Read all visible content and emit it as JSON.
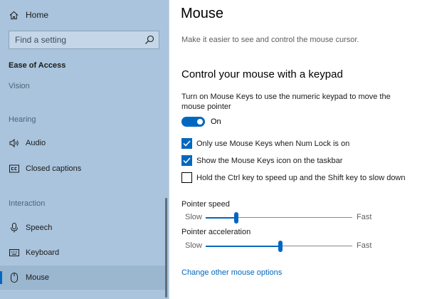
{
  "sidebar": {
    "home_label": "Home",
    "search_placeholder": "Find a setting",
    "section_heading": "Ease of Access",
    "groups": {
      "vision": "Vision",
      "hearing": "Hearing",
      "interaction": "Interaction"
    },
    "items": [
      {
        "label": "Audio",
        "icon": "speaker-icon"
      },
      {
        "label": "Closed captions",
        "icon": "closed-captions-icon"
      },
      {
        "label": "Speech",
        "icon": "microphone-icon"
      },
      {
        "label": "Keyboard",
        "icon": "keyboard-icon"
      },
      {
        "label": "Mouse",
        "icon": "mouse-icon",
        "selected": true
      }
    ]
  },
  "main": {
    "title": "Mouse",
    "description": "Make it easier to see and control the mouse cursor.",
    "section_title": "Control your mouse with a keypad",
    "mouse_keys_intro": "Turn on Mouse Keys to use the numeric keypad to move the mouse pointer",
    "toggle": {
      "state_label": "On",
      "on": true
    },
    "checkboxes": [
      {
        "label": "Only use Mouse Keys when Num Lock is on",
        "checked": true
      },
      {
        "label": "Show the Mouse Keys icon on the taskbar",
        "checked": true
      },
      {
        "label": "Hold the Ctrl key to speed up and the Shift key to slow down",
        "checked": false
      }
    ],
    "sliders": [
      {
        "label": "Pointer speed",
        "min_label": "Slow",
        "max_label": "Fast",
        "value": 0.21
      },
      {
        "label": "Pointer acceleration",
        "min_label": "Slow",
        "max_label": "Fast",
        "value": 0.51
      }
    ],
    "link_label": "Change other mouse options"
  },
  "colors": {
    "accent": "#0067c0",
    "sidebar_bg": "#a9c4dc"
  }
}
